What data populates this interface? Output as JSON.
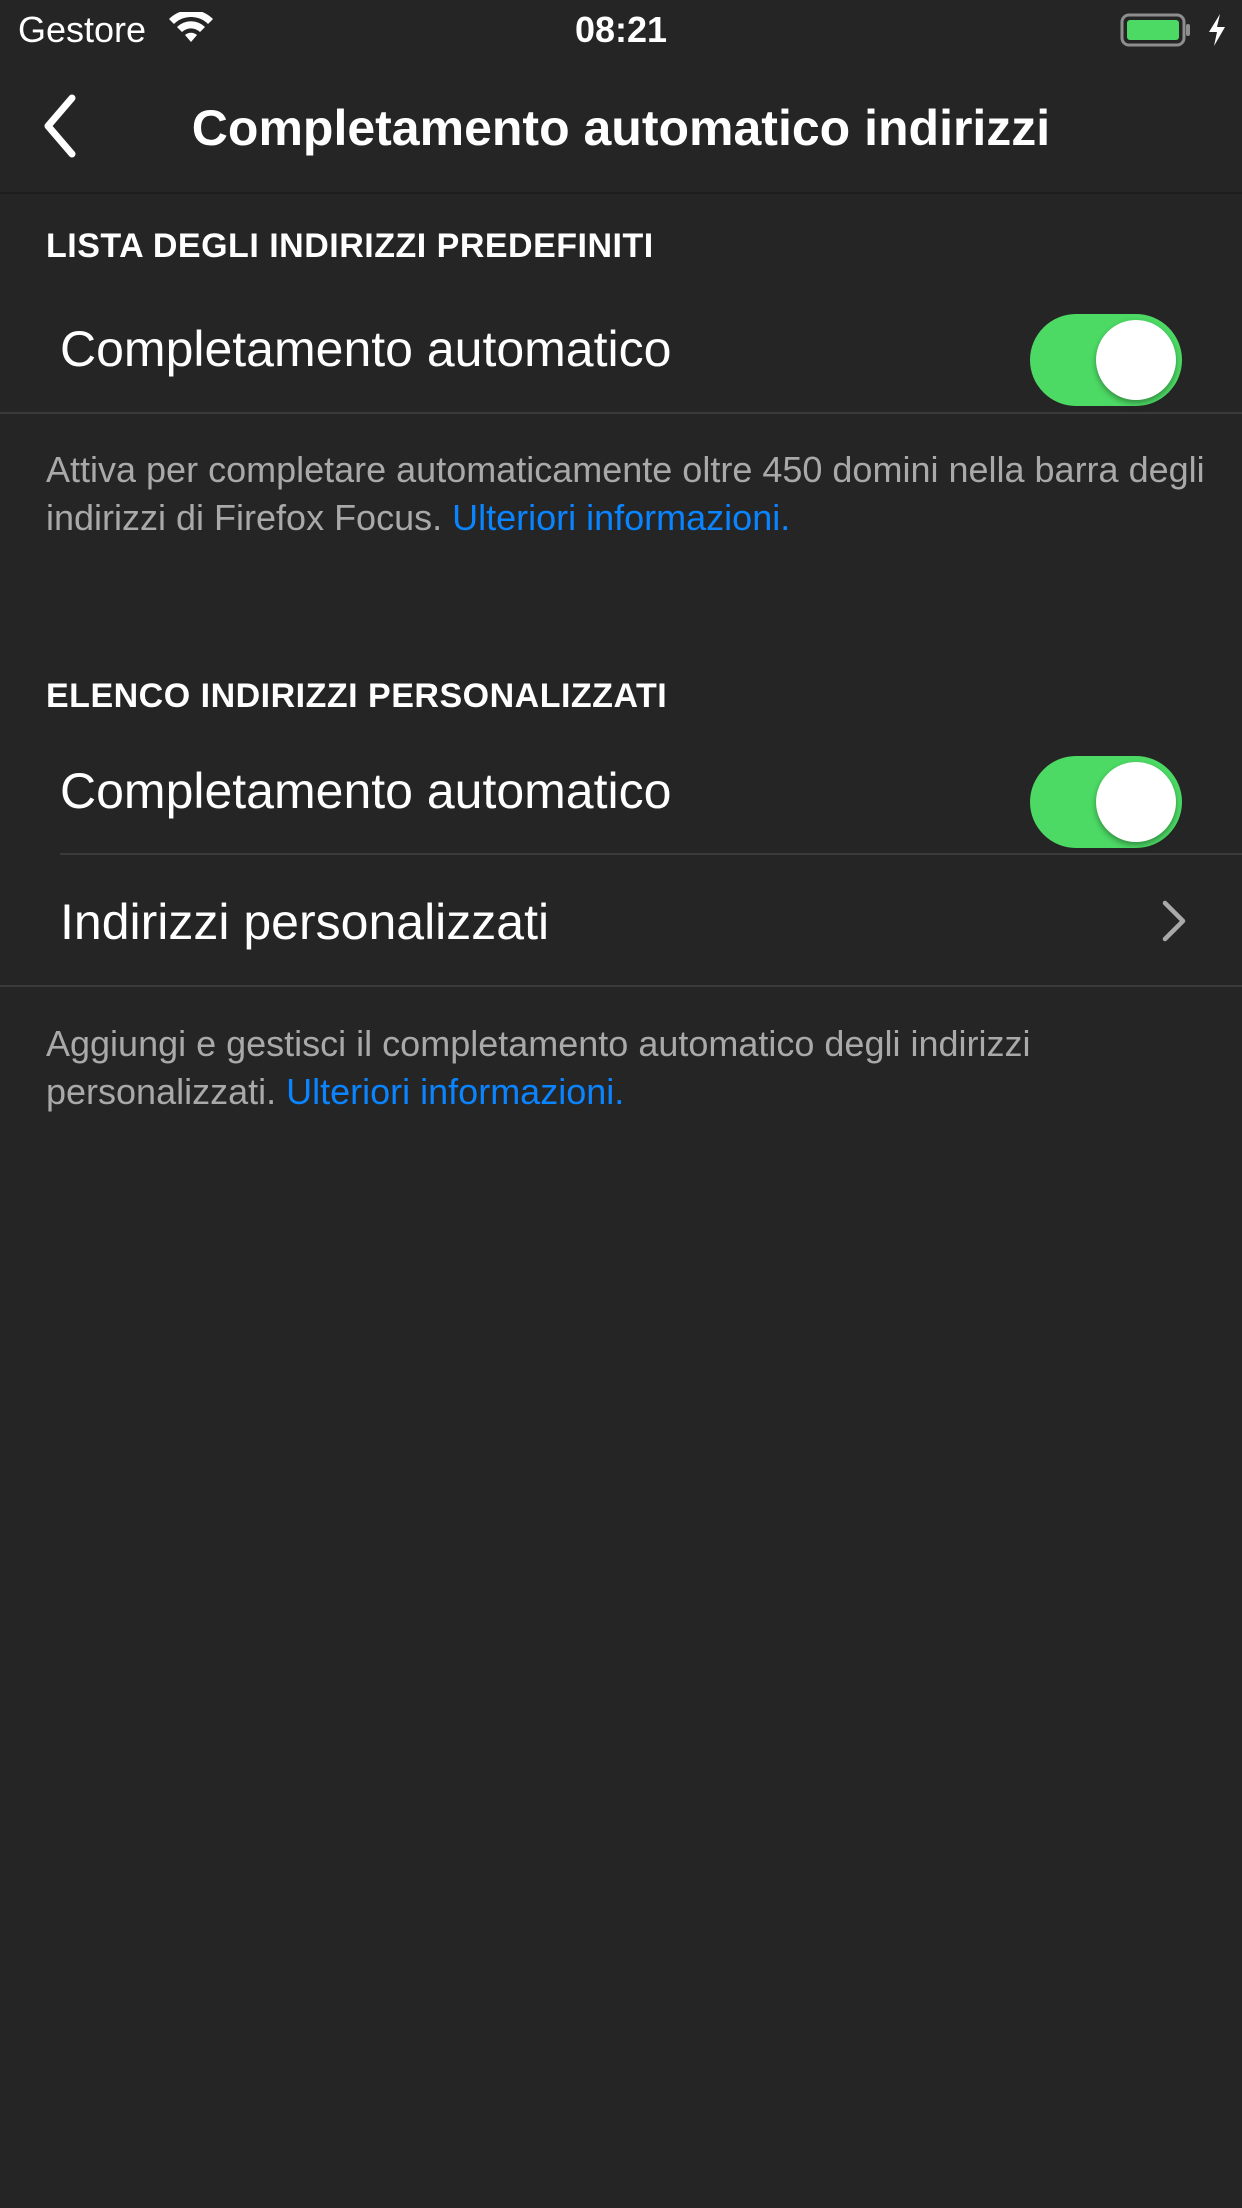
{
  "status_bar": {
    "carrier": "Gestore",
    "time": "08:21",
    "wifi_icon": "wifi-icon",
    "battery_icon": "battery-charging-icon",
    "battery_color": "#4cd964"
  },
  "nav": {
    "title": "Completamento automatico indirizzi",
    "back_icon": "chevron-left-icon"
  },
  "sections": [
    {
      "header": "LISTA DEGLI INDIRIZZI PREDEFINITI",
      "rows": [
        {
          "label": "Completamento automatico",
          "toggle_on": true
        }
      ],
      "footer": "Attiva per completare automaticamente oltre 450 domini nella barra degli indirizzi di Firefox Focus.",
      "footer_link": "Ulteriori informazioni."
    },
    {
      "header": "ELENCO INDIRIZZI PERSONALIZZATI",
      "rows": [
        {
          "label": "Completamento automatico",
          "toggle_on": true
        },
        {
          "label": "Indirizzi personalizzati",
          "accessory": "chevron-right-icon"
        }
      ],
      "footer": "Aggiungi e gestisci il completamento automatico degli indirizzi personalizzati.",
      "footer_link": "Ulteriori informazioni."
    }
  ],
  "colors": {
    "background": "#252525",
    "toggle_on": "#4cd964",
    "link": "#0a84ff",
    "footer_text": "#a9a9a9"
  }
}
